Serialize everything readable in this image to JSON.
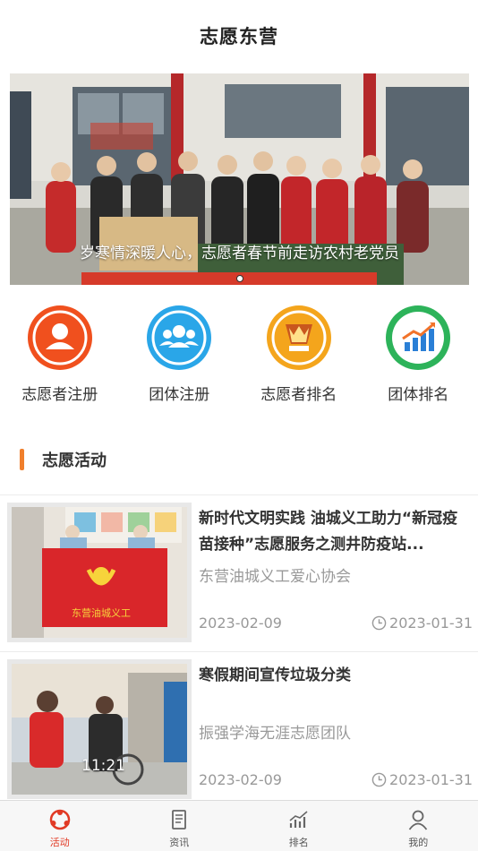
{
  "header": {
    "title": "志愿东营"
  },
  "banner": {
    "caption": "岁寒情深暖人心，志愿者春节前走访农村老党员",
    "active_dot": 1
  },
  "quick_menu": [
    {
      "label": "志愿者注册",
      "icon": "person-icon",
      "color": "#f0501e"
    },
    {
      "label": "团体注册",
      "icon": "group-icon",
      "color": "#2aa6e8"
    },
    {
      "label": "志愿者排名",
      "icon": "trophy-icon",
      "color": "#f4a51c"
    },
    {
      "label": "团体排名",
      "icon": "bar-chart-icon",
      "color": "#2db35a"
    }
  ],
  "section": {
    "title": "志愿活动",
    "accent": "#f07f2c"
  },
  "activities": [
    {
      "title": "新时代文明实践 油城义工助力“新冠疫苗接种”志愿服务之测井防疫站...",
      "org": "东营油城义工爱心协会",
      "start_date": "2023-02-09",
      "end_date": "2023-01-31",
      "flag_text": "东营油城义工"
    },
    {
      "title": "寒假期间宣传垃圾分类",
      "org": "振强学海无涯志愿团队",
      "start_date": "2023-02-09",
      "end_date": "2023-01-31",
      "photo_time": "11:21"
    }
  ],
  "tabbar": [
    {
      "label": "活动",
      "icon": "activity-icon",
      "active": true
    },
    {
      "label": "资讯",
      "icon": "news-icon",
      "active": false
    },
    {
      "label": "排名",
      "icon": "ranking-icon",
      "active": false
    },
    {
      "label": "我的",
      "icon": "profile-icon",
      "active": false
    }
  ]
}
